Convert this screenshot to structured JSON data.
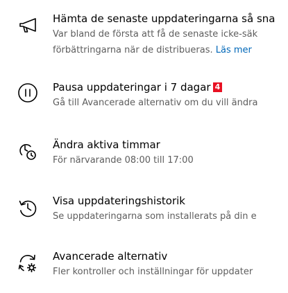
{
  "items": [
    {
      "icon": "megaphone-icon",
      "title": "Hämta de senaste uppdateringarna så sna",
      "desc_line1": "Var bland de första att få de senaste icke-säk",
      "desc_line2": "förbättringarna när de distribueras.",
      "link": "Läs mer"
    },
    {
      "icon": "pause-icon",
      "title": "Pausa uppdateringar i 7 dagar",
      "badge": "4",
      "desc": "Gå till Avancerade alternativ om du vill ändra"
    },
    {
      "icon": "clock-schedule-icon",
      "title": "Ändra aktiva timmar",
      "desc": "För närvarande 08:00 till 17:00"
    },
    {
      "icon": "history-icon",
      "title": "Visa uppdateringshistorik",
      "desc": "Se uppdateringarna som installerats på din e"
    },
    {
      "icon": "sync-gear-icon",
      "title": "Avancerade alternativ",
      "desc": "Fler kontroller och inställningar för uppdater"
    }
  ],
  "colors": {
    "link": "#0067b8",
    "badge": "#e81123",
    "secondary_text": "#5d5d5d"
  }
}
